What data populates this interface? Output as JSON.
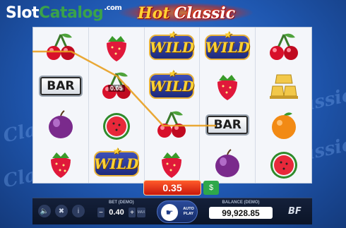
{
  "watermark": {
    "slot": "Slot",
    "catalog": "Catalog",
    "com": ".com"
  },
  "title": {
    "hot": "Hot",
    "classic": "Classic"
  },
  "background": {
    "words": [
      "Classic",
      "Classic",
      "Classic",
      "Classic"
    ]
  },
  "reels": [
    [
      "cherry",
      "bar",
      "plum",
      "strawberry"
    ],
    [
      "strawberry",
      "cherry",
      "watermelon",
      "wild"
    ],
    [
      "wild",
      "wild",
      "cherry",
      "strawberry"
    ],
    [
      "wild",
      "strawberry",
      "bar",
      "plum"
    ],
    [
      "cherry",
      "gold",
      "orange",
      "watermelon"
    ]
  ],
  "symbols": {
    "bar_label": "BAR",
    "wild_label": "WILD"
  },
  "line_win": "0.05",
  "win_amount": "0.35",
  "controls": {
    "bet_label": "BET (DEMO)",
    "bet_value": "0.40",
    "bet_minus": "−",
    "bet_plus": "+",
    "bet_max": "MAX",
    "autoplay_label_1": "AUTO",
    "autoplay_label_2": "PLAY",
    "balance_label": "BALANCE (DEMO)",
    "balance_value": "99,928.85",
    "brand": "BF"
  },
  "colors": {
    "accent_red": "#d8200f",
    "win_green": "#2ea84a",
    "payline": "#e8a020",
    "bg_blue": "#1f57b0"
  }
}
